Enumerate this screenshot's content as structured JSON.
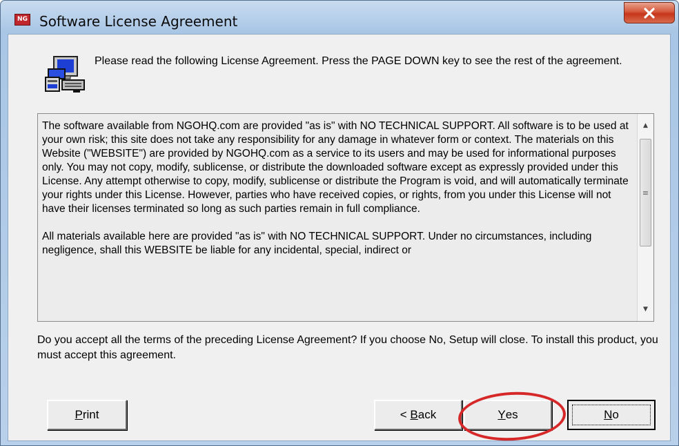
{
  "window": {
    "title": "Software License Agreement",
    "app_icon_text": "NG",
    "close_icon": "close-icon"
  },
  "header": {
    "icon": "computer-setup-icon",
    "instruction": "Please read the following License Agreement. Press the PAGE DOWN key to see the rest of the agreement."
  },
  "license": {
    "paragraphs": [
      "The software available from NGOHQ.com are provided \"as is\" with NO TECHNICAL SUPPORT. All software is to be used at your own risk; this site does not take any responsibility for any damage in whatever form or context. The materials on this Website (\"WEBSITE\") are provided by NGOHQ.com as a service to its users and may be used for informational purposes only. You may not copy, modify, sublicense, or distribute the downloaded software except as expressly provided under this License. Any attempt otherwise to copy, modify, sublicense or distribute the Program is void, and will automatically terminate your rights under this License. However, parties who have received copies, or rights, from you under this License will not have their licenses terminated so long as such parties remain in full compliance.",
      "All materials available here are provided \"as is\" with NO TECHNICAL SUPPORT. Under no circumstances, including negligence, shall this WEBSITE be liable for any incidental, special, indirect or"
    ],
    "scroll_up_icon": "scroll-up-arrow-icon",
    "scroll_down_icon": "scroll-down-arrow-icon"
  },
  "question": "Do you accept all the terms of the preceding License Agreement? If you choose No, Setup will close. To install this product, you must accept this agreement.",
  "buttons": {
    "print": {
      "accel": "P",
      "rest": "rint"
    },
    "back": {
      "prefix": "< ",
      "accel": "B",
      "rest": "ack"
    },
    "yes": {
      "accel": "Y",
      "rest": "es"
    },
    "no": {
      "accel": "N",
      "rest": "o"
    }
  },
  "annotation": {
    "color": "#d62828",
    "target": "yes-button"
  }
}
